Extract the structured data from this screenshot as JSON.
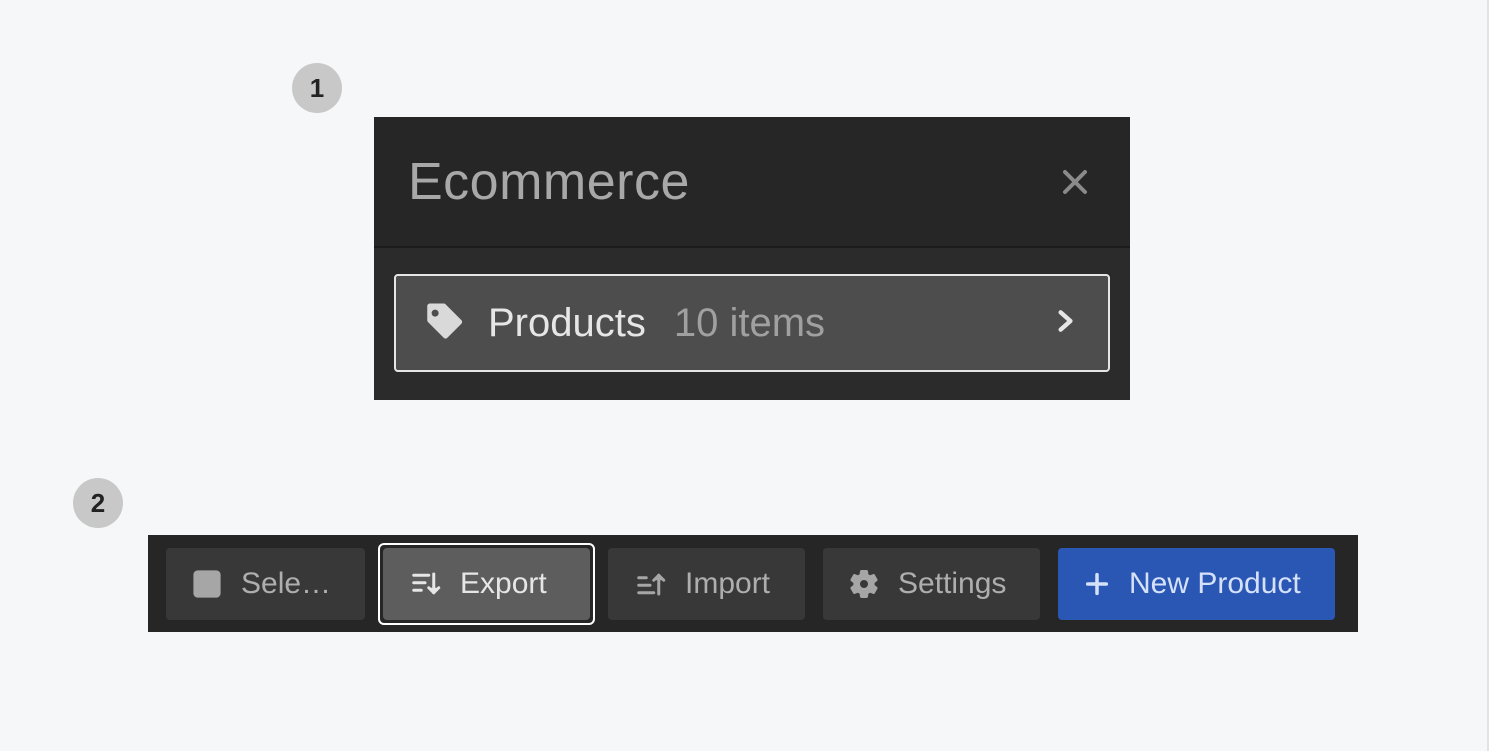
{
  "steps": {
    "one": "1",
    "two": "2"
  },
  "panel1": {
    "title": "Ecommerce",
    "products_label": "Products",
    "products_count": "10 items"
  },
  "toolbar": {
    "select_label": "Select...",
    "export_label": "Export",
    "import_label": "Import",
    "settings_label": "Settings",
    "new_label": "New Product"
  }
}
